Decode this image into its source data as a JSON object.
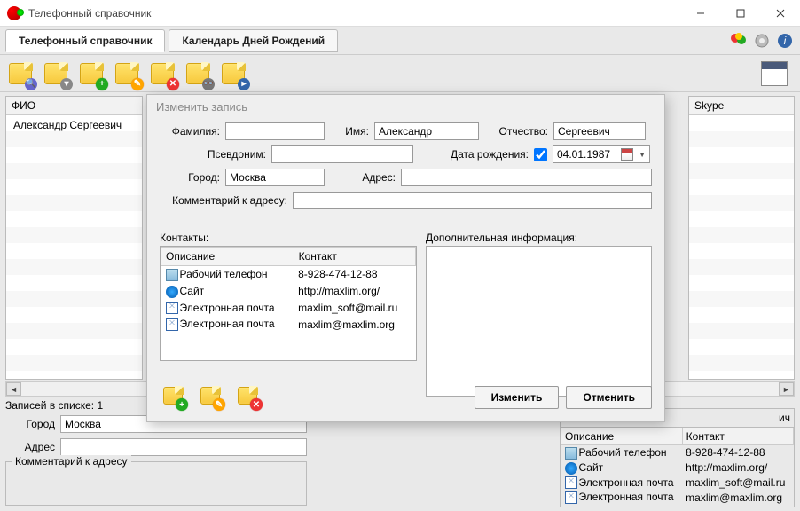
{
  "window": {
    "title": "Телефонный справочник"
  },
  "tabs": {
    "directory": "Телефонный справочник",
    "calendar": "Календарь Дней Рождений"
  },
  "list": {
    "fio_header": "ФИО",
    "skype_header": "Skype",
    "row0": "Александр Сергеевич",
    "count_label": "Записей в списке: 1"
  },
  "left_form": {
    "city_label": "Город",
    "city_value": "Москва",
    "address_label": "Адрес",
    "address_value": "",
    "comment_label": "Комментарий к адресу"
  },
  "modal": {
    "title": "Изменить запись",
    "lastname_label": "Фамилия:",
    "lastname_value": "",
    "firstname_label": "Имя:",
    "firstname_value": "Александр",
    "patronymic_label": "Отчество:",
    "patronymic_value": "Сергеевич",
    "nickname_label": "Псевдоним:",
    "nickname_value": "",
    "birthdate_label": "Дата рождения:",
    "birthdate_value": "04.01.1987",
    "city_label": "Город:",
    "city_value": "Москва",
    "address_label": "Адрес:",
    "address_value": "",
    "addrcomment_label": "Комментарий к адресу:",
    "addrcomment_value": "",
    "contacts_label": "Контакты:",
    "addinfo_label": "Дополнительная информация:",
    "col_desc": "Описание",
    "col_contact": "Контакт",
    "contacts": [
      {
        "type": "phone",
        "desc": "Рабочий телефон",
        "val": "8-928-474-12-88"
      },
      {
        "type": "globe",
        "desc": "Сайт",
        "val": "http://maxlim.org/"
      },
      {
        "type": "mail",
        "desc": "Электронная почта",
        "val": "maxlim_soft@mail.ru"
      },
      {
        "type": "mail",
        "desc": "Электронная почта",
        "val": "maxlim@maxlim.org"
      }
    ],
    "btn_apply": "Изменить",
    "btn_cancel": "Отменить"
  },
  "rightpanel": {
    "ich": "ич",
    "col_desc": "Описание",
    "col_contact": "Контакт"
  }
}
